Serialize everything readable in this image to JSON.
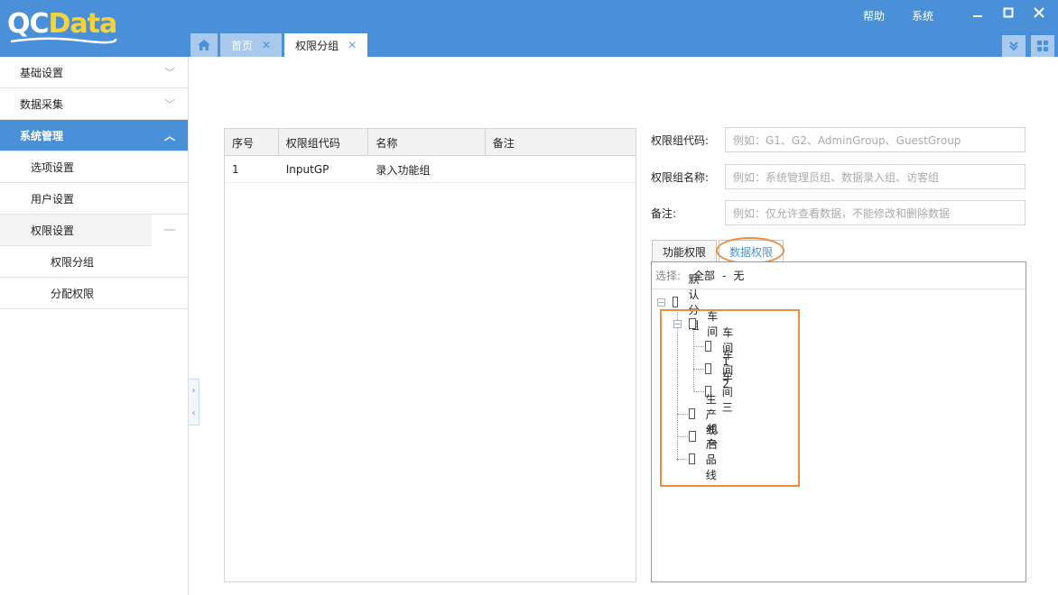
{
  "app": {
    "logo_q": "QC",
    "logo_data": "Data",
    "top_links": [
      "帮助",
      "系统"
    ]
  },
  "icons": {
    "home": "home-icon",
    "minimize": "minimize-icon",
    "maximize": "maximize-icon",
    "close": "close-icon",
    "tabs_menu": "double-chevron-down-icon",
    "apps": "grid-icon"
  },
  "tabs": [
    {
      "label": "首页",
      "active": false
    },
    {
      "label": "权限分组",
      "active": true
    }
  ],
  "sidebar": {
    "items": [
      {
        "label": "基础设置"
      },
      {
        "label": "数据采集"
      },
      {
        "label": "系统管理"
      },
      {
        "label": "选项设置"
      },
      {
        "label": "用户设置"
      },
      {
        "label": "权限设置"
      },
      {
        "label": "权限分组"
      },
      {
        "label": "分配权限"
      }
    ]
  },
  "grid": {
    "columns": [
      "序号",
      "权限组代码",
      "名称",
      "备注"
    ],
    "rows": [
      {
        "seq": "1",
        "code": "InputGP",
        "name": "录入功能组",
        "note": ""
      }
    ]
  },
  "form": {
    "code_label": "权限组代码:",
    "code_placeholder": "例如：G1、G2、AdminGroup、GuestGroup",
    "name_label": "权限组名称:",
    "name_placeholder": "例如：系统管理员组、数据录入组、访客组",
    "note_label": "备注:",
    "note_placeholder": "例如：仅允许查看数据，不能修改和删除数据"
  },
  "perm_tabs": [
    "功能权限",
    "数据权限"
  ],
  "selector": {
    "label": "选择:",
    "all": "全部",
    "sep": "-",
    "none": "无"
  },
  "tree": {
    "root": "默认分组",
    "group": "车间",
    "children": [
      "车间1",
      "车间2",
      "车间三"
    ],
    "siblings": [
      "生产线",
      "机台",
      "产品线"
    ]
  },
  "colors": {
    "header": "#4a90d9",
    "highlight": "#f08c3a"
  }
}
